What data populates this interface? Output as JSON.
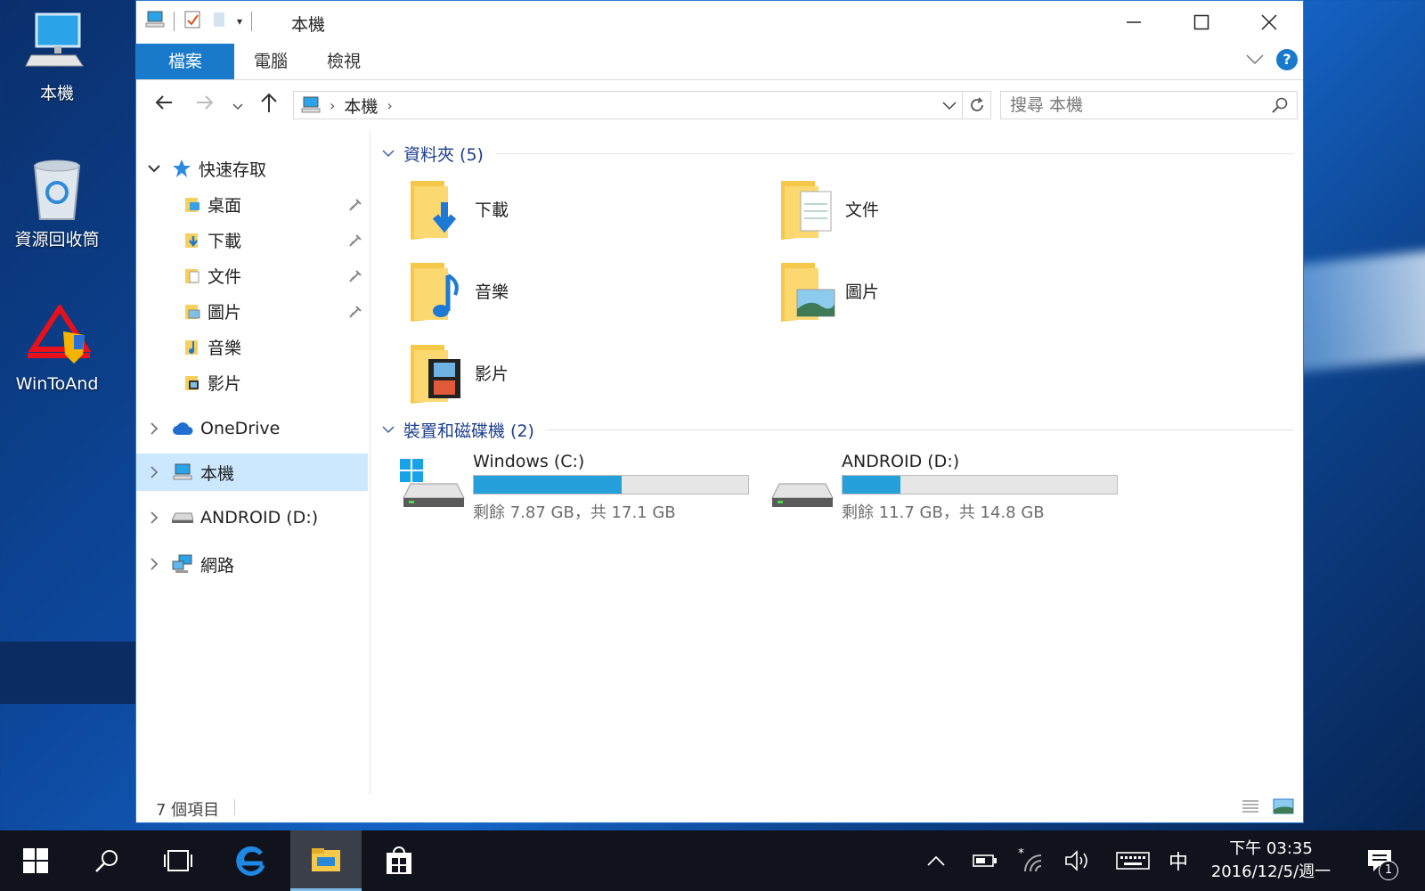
{
  "desktop": {
    "icons": [
      {
        "label": "本機"
      },
      {
        "label": "資源回收筒"
      },
      {
        "label": "WinToAnd"
      }
    ]
  },
  "window": {
    "title": "本機",
    "ribbon_tabs": [
      "檔案",
      "電腦",
      "檢視"
    ],
    "help": "?",
    "address": {
      "current": "本機"
    },
    "search": {
      "placeholder": "搜尋 本機"
    },
    "nav": {
      "quick_access": "快速存取",
      "quick_items": [
        "桌面",
        "下載",
        "文件",
        "圖片",
        "音樂",
        "影片"
      ],
      "onedrive": "OneDrive",
      "this_pc": "本機",
      "android": "ANDROID (D:)",
      "network": "網路"
    },
    "folders": {
      "header": "資料夾 (5)",
      "items": [
        "下載",
        "文件",
        "音樂",
        "圖片",
        "影片"
      ]
    },
    "drives": {
      "header": "裝置和磁碟機 (2)",
      "items": [
        {
          "name": "Windows (C:)",
          "free": "剩餘 7.87 GB，共 17.1 GB",
          "used_fraction": 0.54
        },
        {
          "name": "ANDROID (D:)",
          "free": "剩餘 11.7 GB，共 14.8 GB",
          "used_fraction": 0.21
        }
      ]
    },
    "status": {
      "count": "7 個項目"
    }
  },
  "taskbar": {
    "ime": "中",
    "time": "下午 03:35",
    "date": "2016/12/5/週一",
    "notifications": "1"
  },
  "colors": {
    "accent": "#1979ca",
    "selection": "#cce8ff",
    "drive_fill": "#26a0da",
    "taskbar": "#10131c"
  }
}
